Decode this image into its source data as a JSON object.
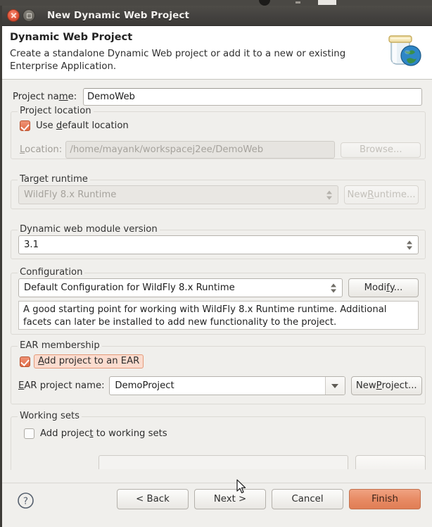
{
  "window": {
    "title": "New Dynamic Web Project",
    "close_tooltip": "Close",
    "maximize_tooltip": "Maximize"
  },
  "header": {
    "title": "Dynamic Web Project",
    "description": "Create a standalone Dynamic Web project or add it to a new or existing Enterprise Application.",
    "icon": "jar-globe-icon"
  },
  "form": {
    "project_name": {
      "label_before": "Project na",
      "label_mnemonic": "m",
      "label_after": "e:",
      "value": "DemoWeb"
    },
    "project_location": {
      "group_title": "Project location",
      "use_default_before": "Use ",
      "use_default_mnemonic": "d",
      "use_default_after": "efault location",
      "use_default_checked": true,
      "location_label_mnemonic": "L",
      "location_label_after": "ocation:",
      "location_value": "/home/mayank/workspacej2ee/DemoWeb",
      "browse_label": "Browse...",
      "browse_enabled": false
    },
    "target_runtime": {
      "group_title": "Target runtime",
      "value": "WildFly 8.x Runtime",
      "enabled": false,
      "new_runtime_before": "New ",
      "new_runtime_mnemonic": "R",
      "new_runtime_after": "untime...",
      "new_runtime_enabled": false
    },
    "dynamic_web_module_version": {
      "group_title": "Dynamic web module version",
      "value": "3.1"
    },
    "configuration": {
      "group_title": "Configuration",
      "value": "Default Configuration for WildFly 8.x Runtime",
      "modify_before": "Modi",
      "modify_mnemonic": "f",
      "modify_after": "y...",
      "description": "A good starting point for working with WildFly 8.x Runtime runtime. Additional facets can later be installed to add new functionality to the project."
    },
    "ear_membership": {
      "group_title": "EAR membership",
      "add_to_ear_mnemonic": "A",
      "add_to_ear_after": "dd project to an EAR",
      "add_to_ear_checked": true,
      "add_to_ear_focused": true,
      "ear_name_label_mnemonic": "E",
      "ear_name_label_after": "AR project name:",
      "ear_name_value": "DemoProject",
      "new_project_before": "New ",
      "new_project_mnemonic": "P",
      "new_project_after": "roject..."
    },
    "working_sets": {
      "group_title": "Working sets",
      "add_to_working_sets_before": "Add projec",
      "add_to_working_sets_mnemonic": "t",
      "add_to_working_sets_after": " to working sets",
      "add_to_working_sets_checked": false
    }
  },
  "footer": {
    "help_icon": "help-question-icon",
    "back_label": "< Back",
    "next_label": "Next >",
    "cancel_label": "Cancel",
    "finish_label": "Finish"
  },
  "colors": {
    "accent_orange": "#e07e55",
    "checkbox_orange": "#e06a45",
    "focus_highlight": "#fbdccf",
    "window_bg": "#f0efec",
    "titlebar": "#444240"
  }
}
